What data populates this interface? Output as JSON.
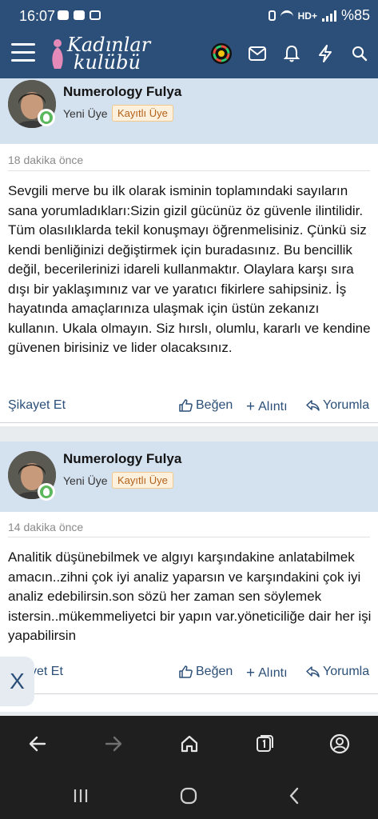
{
  "status_bar": {
    "time": "16:07",
    "battery": "%85",
    "network": "HD+"
  },
  "app": {
    "logo_line1": "Kadınlar",
    "logo_line2": "kulübü",
    "brand_color": "#2b4f78",
    "header_icons": [
      "menu-icon",
      "color-wheel-icon",
      "mail-icon",
      "bell-icon",
      "bolt-icon",
      "search-icon"
    ]
  },
  "posts": [
    {
      "username": "Numerology Fulya",
      "user_title": "Yeni Üye",
      "badge": "Kayıtlı Üye",
      "time": "18 dakika önce",
      "body": "Sevgili merve bu ilk olarak isminin toplamındaki sayıların sana yorumladıkları:Sizin gizil gücünüz öz güvenle ilintilidir. Tüm olasılıklarda tekil konuşmayı öğrenmelisiniz. Çünkü siz kendi benliğinizi değiştirmek için buradasınız. Bu bencillik değil, becerilerinizi idareli kullanmaktır. Olaylara karşı sıra dışı bir yaklaşımınız var ve yaratıcı fikirlere sahipsiniz. İş hayatında amaçlarınıza ulaşmak için üstün zekanızı kullanın. Ukala olmayın. Siz hırslı, olumlu, kararlı ve kendine güvenen birisiniz ve lider olacaksınız.",
      "report_label": "Şikayet Et",
      "like_label": "Beğen",
      "quote_label": "Alıntı",
      "reply_label": "Yorumla"
    },
    {
      "username": "Numerology Fulya",
      "user_title": "Yeni Üye",
      "badge": "Kayıtlı Üye",
      "time": "14 dakika önce",
      "body": "Analitik düşünebilmek ve algıyı karşındakine anlatabilmek amacın..zihni çok iyi analiz yaparsın ve karşındakini çok iyi analiz edebilirsin.son sözü her zaman sen söylemek istersin..mükemmeliyetci bir yapın var.yöneticiliğe dair her işi yapabilirsin",
      "report_label": "yet Et",
      "like_label": "Beğen",
      "quote_label": "Alıntı",
      "reply_label": "Yorumla"
    }
  ],
  "floating": {
    "close_label": "X"
  }
}
